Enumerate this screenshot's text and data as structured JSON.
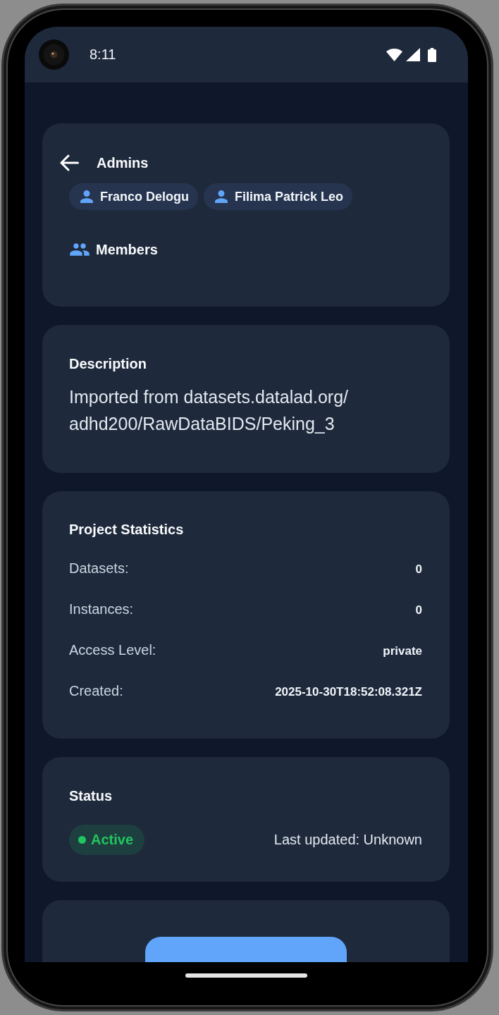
{
  "status_bar": {
    "time": "8:11"
  },
  "header": {
    "title": "Admins"
  },
  "admins": [
    {
      "name": "Franco Delogu"
    },
    {
      "name": "Filima Patrick Leo"
    }
  ],
  "members": {
    "title": "Members"
  },
  "description": {
    "title": "Description",
    "text": "Imported from datasets.datalad.org/adhd200/RawDataBIDS/Peking_3"
  },
  "statistics": {
    "title": "Project Statistics",
    "rows": [
      {
        "label": "Datasets:",
        "value": "0"
      },
      {
        "label": "Instances:",
        "value": "0"
      },
      {
        "label": "Access Level:",
        "value": "private"
      },
      {
        "label": "Created:",
        "value": "2025-10-30T18:52:08.321Z"
      }
    ]
  },
  "status": {
    "title": "Status",
    "badge": {
      "label": "Active",
      "color": "#22c55e"
    },
    "last_updated": "Last updated: Unknown"
  },
  "actions": [
    {
      "kind": "primary"
    }
  ]
}
